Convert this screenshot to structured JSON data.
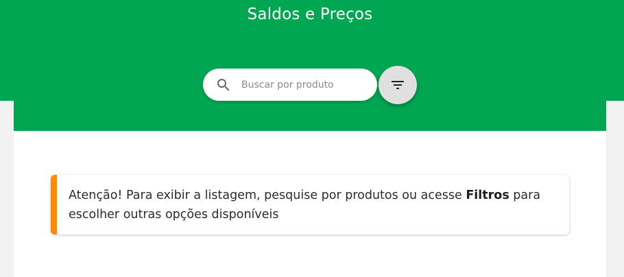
{
  "header": {
    "title": "Saldos e Preços"
  },
  "search": {
    "placeholder": "Buscar por produto",
    "value": "",
    "icon": "search-icon"
  },
  "filter_button": {
    "icon": "filter-icon"
  },
  "alert": {
    "text_before": "Atenção! Para exibir a listagem, pesquise por produtos ou acesse ",
    "emphasis": "Filtros",
    "text_after": " para escolher outras opções disponíveis"
  },
  "colors": {
    "brand_green": "#00a651",
    "alert_accent": "#ff8c00",
    "filter_button_bg": "#e0e0e0"
  }
}
